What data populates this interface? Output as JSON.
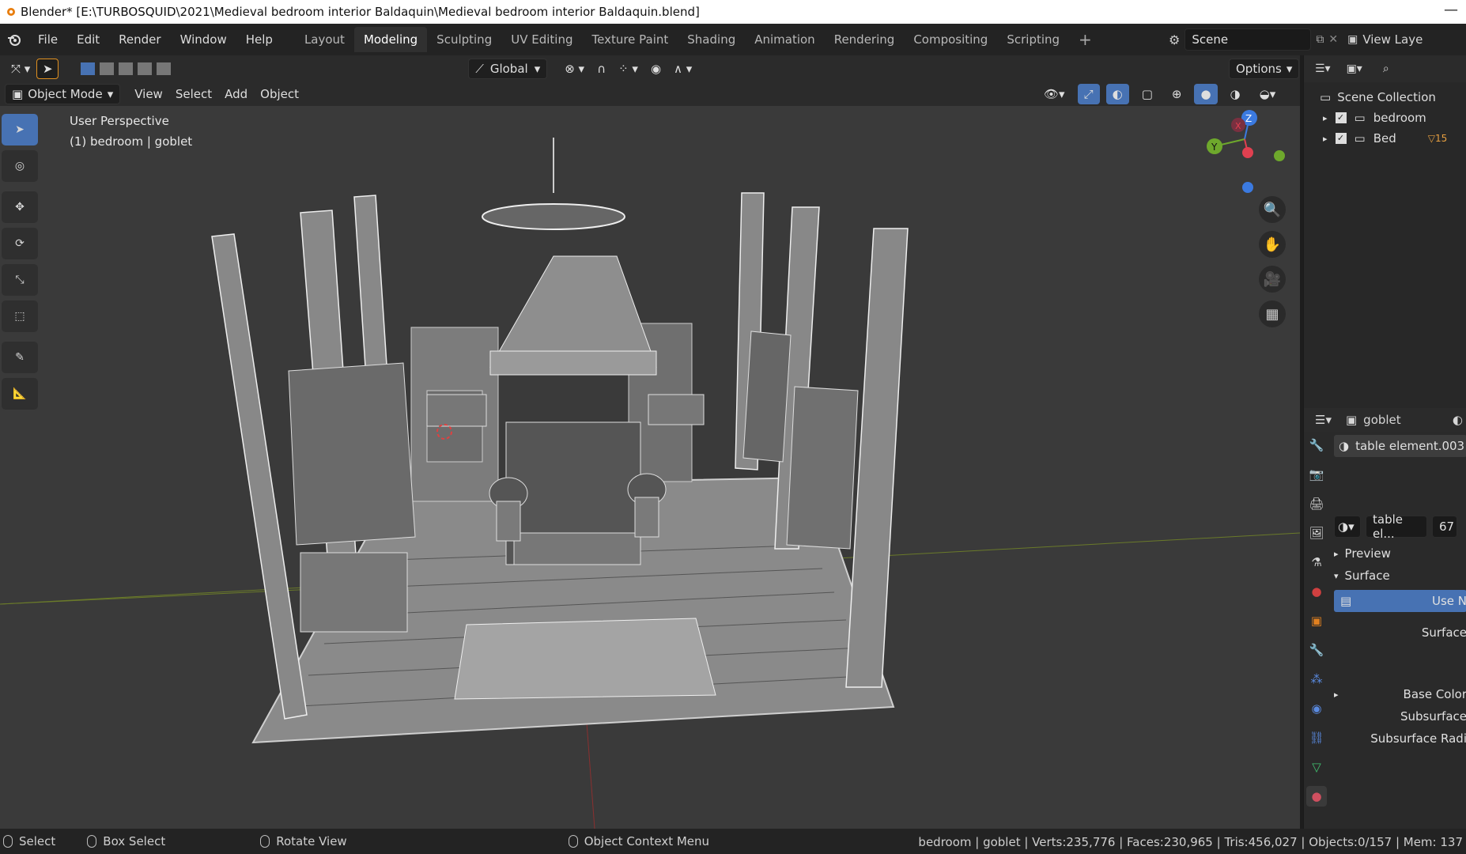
{
  "window": {
    "title": "Blender* [E:\\TURBOSQUID\\2021\\Medieval bedroom interior Baldaquin\\Medieval bedroom interior Baldaquin.blend]"
  },
  "menu": [
    "File",
    "Edit",
    "Render",
    "Window",
    "Help"
  ],
  "workspaces": [
    {
      "label": "Layout",
      "active": false
    },
    {
      "label": "Modeling",
      "active": true
    },
    {
      "label": "Sculpting",
      "active": false
    },
    {
      "label": "UV Editing",
      "active": false
    },
    {
      "label": "Texture Paint",
      "active": false
    },
    {
      "label": "Shading",
      "active": false
    },
    {
      "label": "Animation",
      "active": false
    },
    {
      "label": "Rendering",
      "active": false
    },
    {
      "label": "Compositing",
      "active": false
    },
    {
      "label": "Scripting",
      "active": false
    }
  ],
  "scene": {
    "name": "Scene",
    "view_layer": "View Laye"
  },
  "toolbar": {
    "orientation": "Global",
    "options": "Options"
  },
  "viewport_header": {
    "mode": "Object Mode",
    "menus": [
      "View",
      "Select",
      "Add",
      "Object"
    ]
  },
  "viewport": {
    "perspective": "User Perspective",
    "context": "(1) bedroom  | goblet"
  },
  "outliner": {
    "root": "Scene Collection",
    "items": [
      {
        "label": "bedroom",
        "checked": true
      },
      {
        "label": "Bed",
        "checked": true,
        "badge": "15"
      }
    ]
  },
  "properties": {
    "object": "goblet",
    "material_slot": "table element.003",
    "material_name": "table el...",
    "user_count": "67",
    "panels": {
      "preview": "Preview",
      "surface": "Surface",
      "use_nodes": "Use N"
    },
    "fields": {
      "surface": "Surface",
      "base_color": "Base Color",
      "subsurface": "Subsurface",
      "subsurface_radius": "Subsurface Radi"
    }
  },
  "gizmo": {
    "x": "X",
    "y": "Y",
    "z": "Z"
  },
  "statusbar": {
    "items": [
      "Select",
      "Box Select",
      "Rotate View",
      "Object Context Menu"
    ],
    "stats": "bedroom  | goblet | Verts:235,776 | Faces:230,965 | Tris:456,027 | Objects:0/157 | Mem: 137"
  }
}
